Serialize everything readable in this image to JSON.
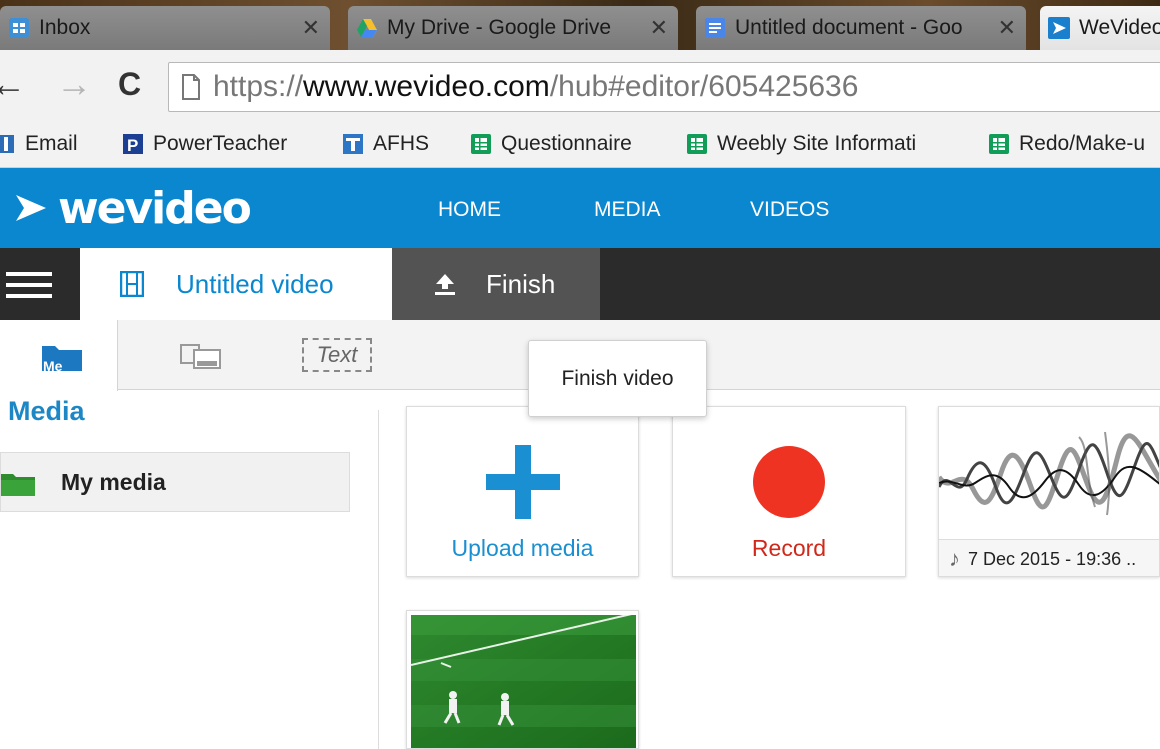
{
  "browser": {
    "tabs": [
      {
        "title": "Inbox",
        "favicon": "sheets-inbox-icon"
      },
      {
        "title": "My Drive - Google Drive",
        "favicon": "google-drive-icon"
      },
      {
        "title": "Untitled document - Goo",
        "favicon": "google-docs-icon"
      },
      {
        "title": "WeVideo",
        "favicon": "wevideo-icon"
      }
    ],
    "close_glyph": "✕",
    "back_glyph": "←",
    "forward_glyph": "→",
    "reload_glyph": "C",
    "url": {
      "scheme": "https://",
      "host": "www.wevideo.com",
      "path": "/hub#editor/605425636"
    },
    "bookmarks": [
      {
        "label": "Email",
        "icon": "email-bookmark-icon"
      },
      {
        "label": "PowerTeacher",
        "icon": "powerteacher-icon"
      },
      {
        "label": "AFHS",
        "icon": "afhs-icon"
      },
      {
        "label": "Questionnaire",
        "icon": "sheets-icon"
      },
      {
        "label": "Weebly Site Informati",
        "icon": "sheets-icon"
      },
      {
        "label": "Redo/Make-u",
        "icon": "sheets-icon"
      }
    ]
  },
  "app": {
    "logo_text": "wevideo",
    "nav": [
      "HOME",
      "MEDIA",
      "VIDEOS"
    ],
    "video_title": "Untitled video",
    "finish_label": "Finish",
    "tooltip": "Finish video",
    "text_tool_label": "Text",
    "media_tab_fragment": "Me"
  },
  "sidebar": {
    "section_title": "Media",
    "items": [
      {
        "label": "My media",
        "icon": "folder-icon"
      }
    ]
  },
  "media": {
    "upload_label": "Upload media",
    "record_label": "Record",
    "audio_item_label": "7 Dec 2015 - 19:36 ..",
    "video_item": "soccer-clip-thumbnail"
  },
  "colors": {
    "brand_blue": "#0a87cf",
    "record_red": "#ee3322",
    "editor_bar": "#2b2b2b",
    "finish_tab": "#535353"
  }
}
